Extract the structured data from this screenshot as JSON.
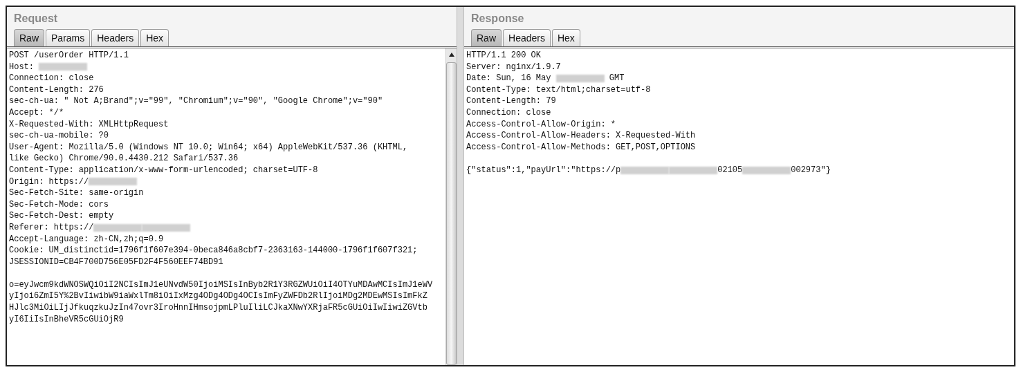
{
  "panes": [
    {
      "title": "Request",
      "tabs": [
        {
          "label": "Raw",
          "selected": true
        },
        {
          "label": "Params",
          "selected": false
        },
        {
          "label": "Headers",
          "selected": false
        },
        {
          "label": "Hex",
          "selected": false
        }
      ],
      "scrollbar": true,
      "blocks": [
        [
          [
            {
              "kind": "text",
              "text": "POST /userOrder HTTP/1.1"
            }
          ],
          [
            {
              "kind": "text",
              "text": "Host: "
            },
            {
              "kind": "redacted"
            }
          ],
          [
            {
              "kind": "text",
              "text": "Connection: close"
            }
          ],
          [
            {
              "kind": "text",
              "text": "Content-Length: 276"
            }
          ],
          [
            {
              "kind": "text",
              "text": "sec-ch-ua: \" Not A;Brand\";v=\"99\", \"Chromium\";v=\"90\", \"Google Chrome\";v=\"90\""
            }
          ],
          [
            {
              "kind": "text",
              "text": "Accept: */*"
            }
          ],
          [
            {
              "kind": "text",
              "text": "X-Requested-With: XMLHttpRequest"
            }
          ],
          [
            {
              "kind": "text",
              "text": "sec-ch-ua-mobile: ?0"
            }
          ],
          [
            {
              "kind": "text",
              "text": "User-Agent: Mozilla/5.0 (Windows NT 10.0; Win64; x64) AppleWebKit/537.36 (KHTML,"
            }
          ],
          [
            {
              "kind": "text",
              "text": "like Gecko) Chrome/90.0.4430.212 Safari/537.36"
            }
          ],
          [
            {
              "kind": "text",
              "text": "Content-Type: application/x-www-form-urlencoded; charset=UTF-8"
            }
          ],
          [
            {
              "kind": "text",
              "text": "Origin: https://"
            },
            {
              "kind": "redacted"
            }
          ],
          [
            {
              "kind": "text",
              "text": "Sec-Fetch-Site: same-origin"
            }
          ],
          [
            {
              "kind": "text",
              "text": "Sec-Fetch-Mode: cors"
            }
          ],
          [
            {
              "kind": "text",
              "text": "Sec-Fetch-Dest: empty"
            }
          ],
          [
            {
              "kind": "text",
              "text": "Referer: https://"
            },
            {
              "kind": "redacted"
            },
            {
              "kind": "redacted"
            }
          ],
          [
            {
              "kind": "text",
              "text": "Accept-Language: zh-CN,zh;q=0.9"
            }
          ],
          [
            {
              "kind": "text",
              "text": "Cookie: UM_distinctid=1796f1f607e394-0beca846a8cbf7-2363163-144000-1796f1f607f321;"
            }
          ],
          [
            {
              "kind": "text",
              "text": "JSESSIONID=CB4F700D756E05FD2F4F560EEF74BD91"
            }
          ]
        ],
        [
          [
            {
              "kind": "text",
              "text": "o=eyJwcm9kdWNOSWQiOiI2NCIsImJ1eUNvdW50IjoiMSIsInByb2R1Y3RGZWUiOiI4OTYuMDAwMCIsImJ1eWV"
            }
          ],
          [
            {
              "kind": "text",
              "text": "yIjoi6ZmI5Y%2BvIiwibW9iaWxlTm8iOiIxMzg4ODg4ODg4OCIsImFyZWFDb2RlIjoiMDg2MDEwMSIsImFkZ"
            }
          ],
          [
            {
              "kind": "text",
              "text": "HJlc3MiOiLIjJfkuqzkuJzIn47ovr3IroHnnIHmsojpmLPluIliLCJkaXNwYXRjaFR5cGUiOiIwIiwiZGVtb"
            }
          ],
          [
            {
              "kind": "text",
              "text": "yI6IiIsInBheVR5cGUiOjR9"
            }
          ]
        ]
      ]
    },
    {
      "title": "Response",
      "tabs": [
        {
          "label": "Raw",
          "selected": true
        },
        {
          "label": "Headers",
          "selected": false
        },
        {
          "label": "Hex",
          "selected": false
        }
      ],
      "scrollbar": false,
      "blocks": [
        [
          [
            {
              "kind": "text",
              "text": "HTTP/1.1 200 OK"
            }
          ],
          [
            {
              "kind": "text",
              "text": "Server: nginx/1.9.7"
            }
          ],
          [
            {
              "kind": "text",
              "text": "Date: Sun, 16 May "
            },
            {
              "kind": "redacted"
            },
            {
              "kind": "text",
              "text": " GMT"
            }
          ],
          [
            {
              "kind": "text",
              "text": "Content-Type: text/html;charset=utf-8"
            }
          ],
          [
            {
              "kind": "text",
              "text": "Content-Length: 79"
            }
          ],
          [
            {
              "kind": "text",
              "text": "Connection: close"
            }
          ],
          [
            {
              "kind": "text",
              "text": "Access-Control-Allow-Origin: *"
            }
          ],
          [
            {
              "kind": "text",
              "text": "Access-Control-Allow-Headers: X-Requested-With"
            }
          ],
          [
            {
              "kind": "text",
              "text": "Access-Control-Allow-Methods: GET,POST,OPTIONS"
            }
          ]
        ],
        [
          [
            {
              "kind": "text",
              "text": "{\"status\":1,\"payUrl\":\"https://p"
            },
            {
              "kind": "redacted"
            },
            {
              "kind": "redacted"
            },
            {
              "kind": "text",
              "text": "02105"
            },
            {
              "kind": "redacted"
            },
            {
              "kind": "text",
              "text": "002973\"}"
            }
          ]
        ]
      ]
    }
  ]
}
